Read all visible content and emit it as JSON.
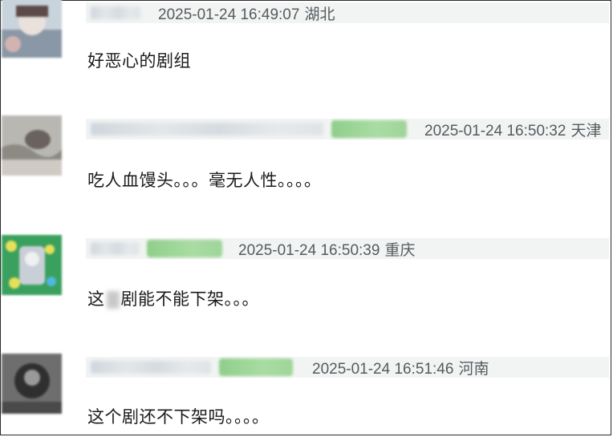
{
  "comments": [
    {
      "timestamp": "2025-01-24 16:49:07",
      "location": "湖北",
      "text": "好恶心的剧组"
    },
    {
      "timestamp": "2025-01-24 16:50:32",
      "location": "天津",
      "text": "吃人血馒头。。。毫无人性。。。。"
    },
    {
      "timestamp": "2025-01-24 16:50:39",
      "location": "重庆",
      "text_before": "这",
      "text_after": "剧能不能下架。。。"
    },
    {
      "timestamp": "2025-01-24 16:51:46",
      "location": "河南",
      "text": "这个剧还不下架吗。。。。"
    }
  ],
  "colors": {
    "meta_bar": "#f2f4f3",
    "meta_text": "#555b60",
    "badge_green": "#9fd598",
    "content_text": "#1a1a1a"
  }
}
